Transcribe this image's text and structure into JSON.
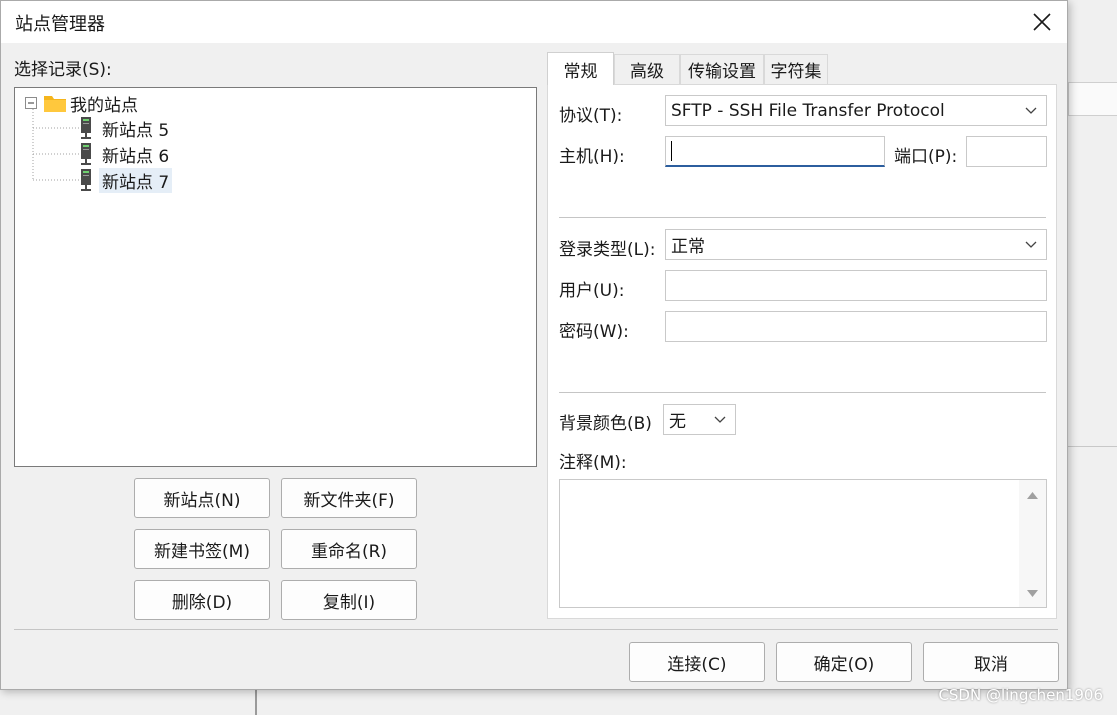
{
  "window": {
    "title": "站点管理器"
  },
  "tree": {
    "label": "选择记录(S):",
    "root": "我的站点",
    "items": [
      "新站点 5",
      "新站点 6",
      "新站点 7"
    ],
    "selected_index": 2
  },
  "buttons": {
    "new_site": "新站点(N)",
    "new_folder": "新文件夹(F)",
    "new_bookmark": "新建书签(M)",
    "rename": "重命名(R)",
    "delete": "删除(D)",
    "copy": "复制(I)"
  },
  "tabs": [
    {
      "label": "常规",
      "active": true
    },
    {
      "label": "高级",
      "active": false
    },
    {
      "label": "传输设置",
      "active": false
    },
    {
      "label": "字符集",
      "active": false
    }
  ],
  "general": {
    "protocol_label": "协议(T):",
    "protocol_value": "SFTP - SSH File Transfer Protocol",
    "host_label": "主机(H):",
    "host_value": "",
    "port_label": "端口(P):",
    "port_value": "",
    "logon_type_label": "登录类型(L):",
    "logon_type_value": "正常",
    "user_label": "用户(U):",
    "user_value": "",
    "password_label": "密码(W):",
    "password_value": "",
    "bg_color_label": "背景颜色(B)",
    "bg_color_value": "无",
    "comments_label": "注释(M):",
    "comments_value": ""
  },
  "footer": {
    "connect": "连接(C)",
    "ok": "确定(O)",
    "cancel": "取消"
  },
  "watermark": "CSDN @lingchen1906",
  "colors": {
    "focus_underline": "#2c5e9e",
    "folder": "#f5b51c",
    "selection": "#e5eef7"
  }
}
